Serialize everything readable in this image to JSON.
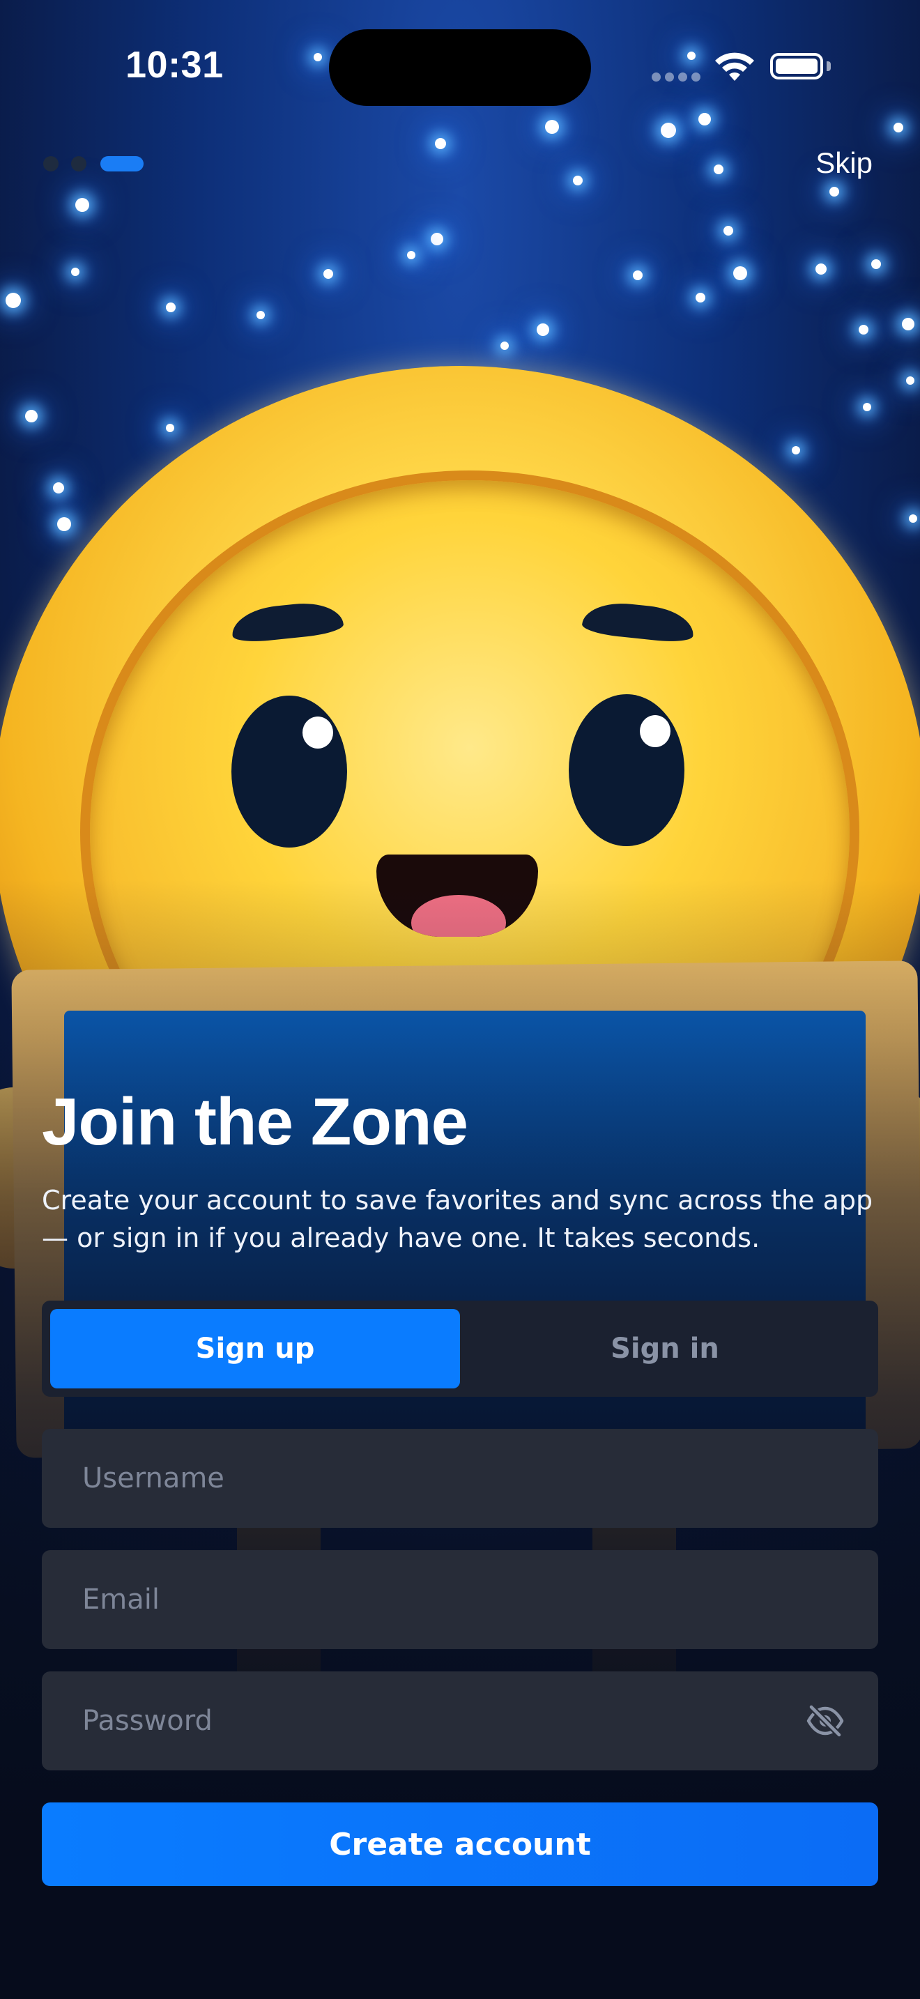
{
  "status_bar": {
    "time": "10:31"
  },
  "onboarding": {
    "page_count": 3,
    "current_page": 3,
    "skip_label": "Skip"
  },
  "auth": {
    "title": "Join the Zone",
    "subtitle": "Create your account to save favorites and sync across the app — or sign in if you already have one. It takes seconds.",
    "tabs": [
      {
        "label": "Sign up",
        "selected": true
      },
      {
        "label": "Sign in",
        "selected": false
      }
    ],
    "fields": {
      "username": {
        "placeholder": "Username",
        "value": ""
      },
      "email": {
        "placeholder": "Email",
        "value": ""
      },
      "password": {
        "placeholder": "Password",
        "value": ""
      }
    },
    "password_toggle_icon": "eye-slash-icon",
    "submit_label": "Create account"
  },
  "colors": {
    "accent": "#0A7CFF",
    "field_background": "#272C38",
    "segment_background": "#1B2130",
    "inactive_text": "#8A93A6"
  }
}
